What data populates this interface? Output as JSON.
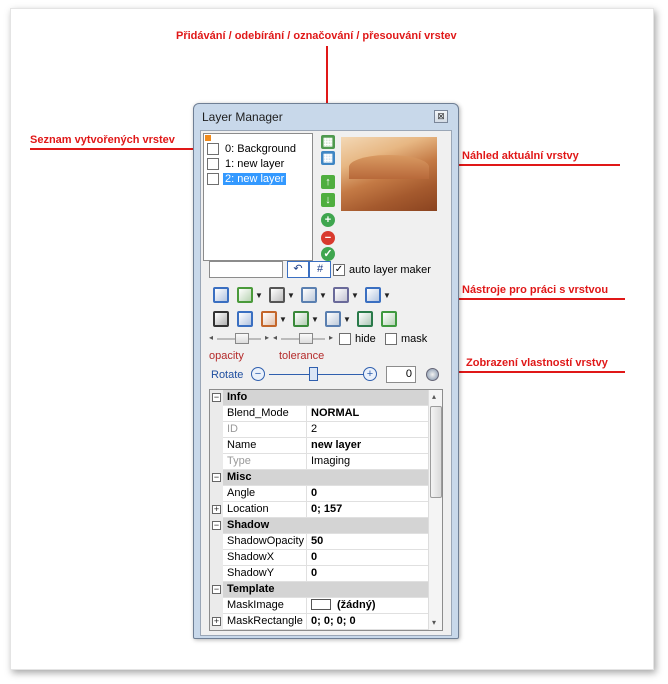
{
  "annotations": {
    "top": "Přidávání / odebírání / označování / přesouvání vrstev",
    "left": "Seznam vytvořených vrstev",
    "preview": "Náhled aktuální vrstvy",
    "tools": "Nástroje pro práci s vrstvou",
    "props": "Zobrazení vlastností vrstvy"
  },
  "window": {
    "title": "Layer Manager",
    "close": "⊠"
  },
  "layers": [
    {
      "label": "0: Background",
      "selected": false
    },
    {
      "label": "1: new layer",
      "selected": false
    },
    {
      "label": "2: new layer",
      "selected": true
    }
  ],
  "layer_buttons": [
    {
      "icon": "film-icon",
      "glyph": "▦",
      "color": "#4f9a4f"
    },
    {
      "icon": "grid-icon",
      "glyph": "▦",
      "color": "#3f86c4"
    },
    {
      "icon": "arrow-up-icon",
      "glyph": "↑",
      "color": "#4fae3f"
    },
    {
      "icon": "arrow-down-icon",
      "glyph": "↓",
      "color": "#4fae3f"
    },
    {
      "icon": "add-icon",
      "glyph": "+",
      "color": "#3fa64f"
    },
    {
      "icon": "remove-icon",
      "glyph": "−",
      "color": "#d93a2e"
    },
    {
      "icon": "confirm-icon",
      "glyph": "✓",
      "color": "#3fa64f"
    }
  ],
  "controls": {
    "name_value": "",
    "undo_glyph": "↶",
    "hash_glyph": "#",
    "auto_layer_maker": "auto layer maker",
    "auto_checked": "✓",
    "hide": "hide",
    "mask": "mask",
    "opacity": "opacity",
    "tolerance": "tolerance",
    "rotate": "Rotate",
    "rotate_value": "0",
    "minus": "−",
    "plus": "+"
  },
  "toolbar_rows": [
    [
      {
        "icon": "align-vertical-icon",
        "color": "#3a6fc1",
        "dropdown": false
      },
      {
        "icon": "tree-icon",
        "color": "#4a9a3a",
        "dropdown": true
      },
      {
        "icon": "crop-icon",
        "color": "#555555",
        "dropdown": true
      },
      {
        "icon": "copy-icon",
        "color": "#5a7fb0",
        "dropdown": true
      },
      {
        "icon": "paste-icon",
        "color": "#6a6a9a",
        "dropdown": true
      },
      {
        "icon": "hierarchy-icon",
        "color": "#3a6fc1",
        "dropdown": true
      }
    ],
    [
      {
        "icon": "globe-icon",
        "color": "#333333",
        "dropdown": false
      },
      {
        "icon": "transform-icon",
        "color": "#3a6fc1",
        "dropdown": false
      },
      {
        "icon": "pattern-icon",
        "color": "#c4662a",
        "dropdown": true
      },
      {
        "icon": "flip-icon",
        "color": "#3a8a3a",
        "dropdown": true
      },
      {
        "icon": "mirror-icon",
        "color": "#5a7fb0",
        "dropdown": true
      },
      {
        "icon": "filter-icon",
        "color": "#2a7a4a",
        "dropdown": false
      },
      {
        "icon": "image-icon",
        "color": "#3f9a3f",
        "dropdown": false
      }
    ]
  ],
  "properties": [
    {
      "kind": "cat",
      "name": "Info"
    },
    {
      "kind": "row",
      "name": "Blend_Mode",
      "value": "NORMAL",
      "bold": true
    },
    {
      "kind": "row",
      "name": "ID",
      "value": "2",
      "grey": true
    },
    {
      "kind": "row",
      "name": "Name",
      "value": "new layer",
      "bold": true
    },
    {
      "kind": "row",
      "name": "Type",
      "value": "Imaging",
      "grey": true
    },
    {
      "kind": "cat",
      "name": "Misc"
    },
    {
      "kind": "row",
      "name": "Angle",
      "value": "0",
      "bold": true
    },
    {
      "kind": "row",
      "name": "Location",
      "value": "0; 157",
      "bold": true,
      "expand": true
    },
    {
      "kind": "cat",
      "name": "Shadow"
    },
    {
      "kind": "row",
      "name": "ShadowOpacity",
      "value": "50",
      "bold": true
    },
    {
      "kind": "row",
      "name": "ShadowX",
      "value": "0",
      "bold": true
    },
    {
      "kind": "row",
      "name": "ShadowY",
      "value": "0",
      "bold": true
    },
    {
      "kind": "cat",
      "name": "Template"
    },
    {
      "kind": "row",
      "name": "MaskImage",
      "value": "(žádný)",
      "bold": true,
      "swatch": true
    },
    {
      "kind": "row",
      "name": "MaskRectangle",
      "value": "0; 0; 0; 0",
      "bold": true,
      "expand": true
    }
  ],
  "category_glyph": "−",
  "expand_glyph": "+"
}
